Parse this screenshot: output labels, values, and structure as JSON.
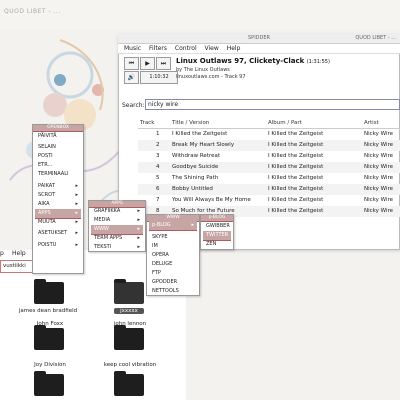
{
  "desktop": {
    "top_title": "QUOD LIBET - ..."
  },
  "quodlibet": {
    "window_title": "QUOD LIBET - ...",
    "window_title_center": "SPIDDER",
    "menu": [
      "Music",
      "Filters",
      "Control",
      "View",
      "Help"
    ],
    "controls": {
      "prev": "⏮",
      "play": "▶",
      "next": "⏭",
      "volume": "🔊",
      "time": "1:10:32"
    },
    "now_playing": {
      "title": "Linux Outlaws 97, Clickety-Clack",
      "duration": "(1:31:55)",
      "by": "by The Linux Outlaws",
      "from": "linuxoutlaws.com - Track 97"
    },
    "search": {
      "label": "Search:",
      "value": "nicky wire"
    },
    "table": {
      "columns": [
        "Track",
        "Title / Version",
        "Album / Part",
        "Artist"
      ],
      "rows": [
        {
          "track": "1",
          "title": "I Killed the Zeitgeist",
          "album": "I Killed the Zeitgeist",
          "artist": "Nicky Wire"
        },
        {
          "track": "2",
          "title": "Break My Heart Slowly",
          "album": "I Killed the Zeitgeist",
          "artist": "Nicky Wire"
        },
        {
          "track": "3",
          "title": "Withdraw Retreat",
          "album": "I Killed the Zeitgeist",
          "artist": "Nicky Wire"
        },
        {
          "track": "4",
          "title": "Goodbye Suicide",
          "album": "I Killed the Zeitgeist",
          "artist": "Nicky Wire"
        },
        {
          "track": "5",
          "title": "The Shining Path",
          "album": "I Killed the Zeitgeist",
          "artist": "Nicky Wire"
        },
        {
          "track": "6",
          "title": "Bobby Untitled",
          "album": "I Killed the Zeitgeist",
          "artist": "Nicky Wire"
        },
        {
          "track": "7",
          "title": "You Will Always Be My Home",
          "album": "I Killed the Zeitgeist",
          "artist": "Nicky Wire"
        },
        {
          "track": "8",
          "title": "So Much for the Future",
          "album": "I Killed the Zeitgeist",
          "artist": "Nicky Wire"
        }
      ]
    }
  },
  "menu_root": {
    "header": "OPENBOX",
    "items": [
      "PÄIVITÄ",
      "SELAIN",
      "POSTI",
      "ETR...",
      "TERMINAALI",
      "PAIKAT",
      "SCROT",
      "AIKA",
      "APPS",
      "MUUTA",
      "ASETUKSET",
      "POISTU"
    ]
  },
  "menu_apps": {
    "header": "APPS",
    "items": [
      "GRAFIIKKA",
      "MEDIA",
      "WWW",
      "TERM APPS",
      "TEKSTI"
    ]
  },
  "menu_www": {
    "header": "WWW",
    "items": [
      "p-BLOG",
      "SKYPE",
      "IM",
      "OPERA",
      "DELUGE",
      "FTP",
      "GPODDER",
      "NETTOOLS"
    ]
  },
  "menu_blog": {
    "header": "p-BLOG",
    "items": [
      "GWIBBER",
      "TWITTER",
      "ZEN"
    ]
  },
  "filemanager": {
    "menu": [
      "p",
      "Help"
    ],
    "location": "vustiikki",
    "folders": [
      {
        "label": "james dean bradfield",
        "selected": false
      },
      {
        "label": "jxxxxx",
        "selected": true
      },
      {
        "label": "John Foxx",
        "selected": false
      },
      {
        "label": "john lennon",
        "selected": false
      },
      {
        "label": "Joy Division",
        "selected": false
      },
      {
        "label": "keep cool vibration",
        "selected": false
      }
    ]
  },
  "colors": {
    "accent": "#c8a5a5",
    "accent_dark": "#b35a5a"
  }
}
